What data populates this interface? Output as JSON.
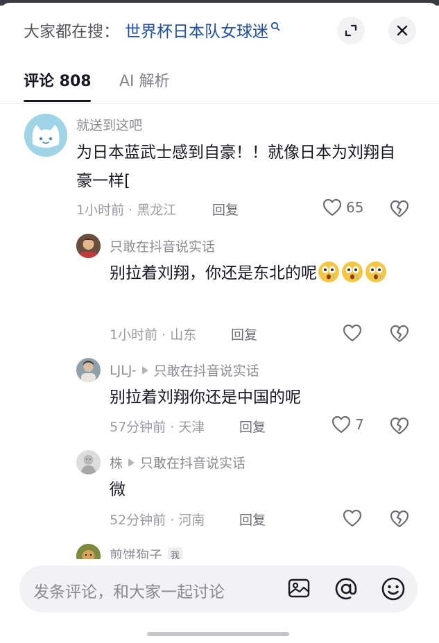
{
  "header": {
    "search_prefix": "大家都在搜：",
    "search_term": "世界杯日本队女球迷",
    "expand_icon": "expand-icon",
    "close_icon": "close-icon"
  },
  "tabs": [
    {
      "label": "评论 808",
      "active": true
    },
    {
      "label": "AI 解析",
      "active": false
    }
  ],
  "comments": [
    {
      "username": "就送到这吧",
      "text": "为日本蓝武士感到自豪！！就像日本为刘翔自豪一样[",
      "time": "1小时前",
      "location": "黑龙江",
      "reply_label": "回复",
      "likes": "65"
    }
  ],
  "replies": [
    {
      "username": "只敢在抖音说实话",
      "text": "别拉着刘翔，你还是东北的呢",
      "emoji": "surprised-face-emoji",
      "time": "1小时前",
      "location": "山东",
      "reply_label": "回复",
      "likes": ""
    },
    {
      "username": "LJLJ-",
      "reply_to": "只敢在抖音说实话",
      "text": "别拉着刘翔你还是中国的呢",
      "time": "57分钟前",
      "location": "天津",
      "reply_label": "回复",
      "likes": "7"
    },
    {
      "username": "株",
      "reply_to": "只敢在抖音说实话",
      "text": "微",
      "time": "52分钟前",
      "location": "河南",
      "reply_label": "回复",
      "likes": ""
    },
    {
      "username": "煎饼狗子",
      "tag": "我"
    }
  ],
  "input": {
    "placeholder": "发条评论，和大家一起讨论",
    "icons": [
      "image-icon",
      "at-icon",
      "emoji-icon"
    ]
  },
  "colors": {
    "search_term": "#1f4fa0",
    "text_primary": "#161823",
    "text_secondary": "#8a8b91",
    "input_bg": "#f2f2f4"
  }
}
